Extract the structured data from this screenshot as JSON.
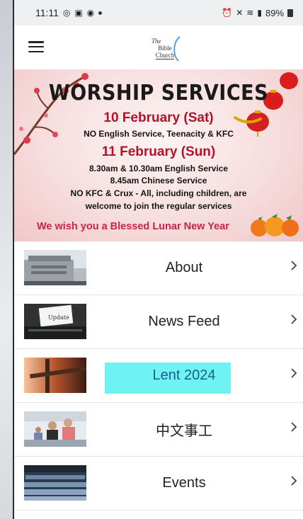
{
  "status_bar": {
    "time": "11:11",
    "battery": "89%"
  },
  "banner": {
    "title": "WORSHIP SERVICES",
    "date1": "10 February (Sat)",
    "line1": "NO English Service, Teenacity & KFC",
    "date2": "11 February (Sun)",
    "line2": "8.30am & 10.30am English Service",
    "line3": "8.45am Chinese Service",
    "line4": "NO KFC & Crux - All, including children, are",
    "line5": "welcome to join the regular services",
    "wish": "We wish you a Blessed Lunar New Year"
  },
  "logo": {
    "the": "The",
    "line1": "Bible",
    "line2": "Church"
  },
  "menu": [
    {
      "label": "About",
      "thumb": "building-photo"
    },
    {
      "label": "News Feed",
      "thumb": "typewriter-update-photo"
    },
    {
      "label": "Lent 2024",
      "thumb": "cross-photo"
    },
    {
      "label": "中文事工",
      "thumb": "group-photo"
    },
    {
      "label": "Events",
      "thumb": "auditorium-photo"
    }
  ],
  "colors": {
    "accent_red": "#b2122a",
    "wish_pink": "#c8254a",
    "highlight": "#5ef1f1"
  }
}
